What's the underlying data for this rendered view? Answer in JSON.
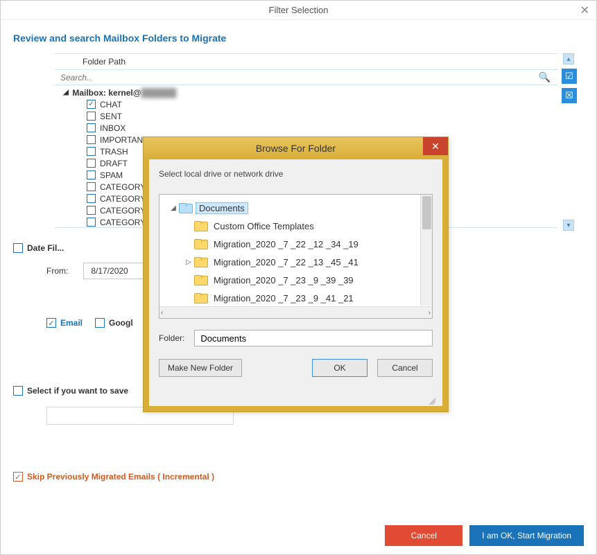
{
  "window": {
    "title": "Filter Selection",
    "close_glyph": "✕"
  },
  "section_title": "Review and search Mailbox Folders to Migrate",
  "tree": {
    "header": "Folder Path",
    "search_placeholder": "Search..",
    "search_icon_glyph": "🔍",
    "root_label_prefix": "Mailbox",
    "root_label_account": "kernel@",
    "root_label_blur": "██████",
    "items": [
      {
        "label": "CHAT",
        "checked": true
      },
      {
        "label": "SENT",
        "checked": false
      },
      {
        "label": "INBOX",
        "checked": false
      },
      {
        "label": "IMPORTANT",
        "checked": false
      },
      {
        "label": "TRASH",
        "checked": false
      },
      {
        "label": "DRAFT",
        "checked": false
      },
      {
        "label": "SPAM",
        "checked": false
      },
      {
        "label": "CATEGORY_FO",
        "checked": false
      },
      {
        "label": "CATEGORY_UP",
        "checked": false
      },
      {
        "label": "CATEGORY_PE",
        "checked": false
      },
      {
        "label": "CATEGORY_PR",
        "checked": false
      },
      {
        "label": "CATEGORY_SO",
        "checked": false
      }
    ],
    "side": {
      "up_glyph": "▴",
      "select_all_glyph": "☑",
      "deselect_all_glyph": "☒",
      "down_glyph": "▾"
    }
  },
  "date_filter": {
    "label": "Date Fil...",
    "from_label": "From:",
    "from_value": "8/17/2020"
  },
  "types": {
    "email_label": "Email",
    "google_label": "Googl"
  },
  "save_row": {
    "label": "Select if you want to save"
  },
  "skip_row": {
    "label": "Skip Previously Migrated Emails ( Incremental )"
  },
  "footer": {
    "cancel": "Cancel",
    "start": "I am OK, Start Migration"
  },
  "modal": {
    "title": "Browse For Folder",
    "close_glyph": "✕",
    "hint": "Select local drive or network drive",
    "tree": {
      "root": "Documents",
      "children": [
        {
          "label": "Custom Office Templates",
          "expandable": false
        },
        {
          "label": "Migration_2020 _7 _22 _12 _34 _19",
          "expandable": false
        },
        {
          "label": "Migration_2020 _7 _22 _13 _45 _41",
          "expandable": true
        },
        {
          "label": "Migration_2020 _7 _23 _9 _39 _39",
          "expandable": false
        },
        {
          "label": "Migration_2020 _7 _23 _9 _41 _21",
          "expandable": false
        }
      ],
      "hscroll_left": "‹",
      "hscroll_right": "›"
    },
    "folder_label": "Folder:",
    "folder_value": "Documents",
    "make_new": "Make New Folder",
    "ok": "OK",
    "cancel": "Cancel"
  }
}
